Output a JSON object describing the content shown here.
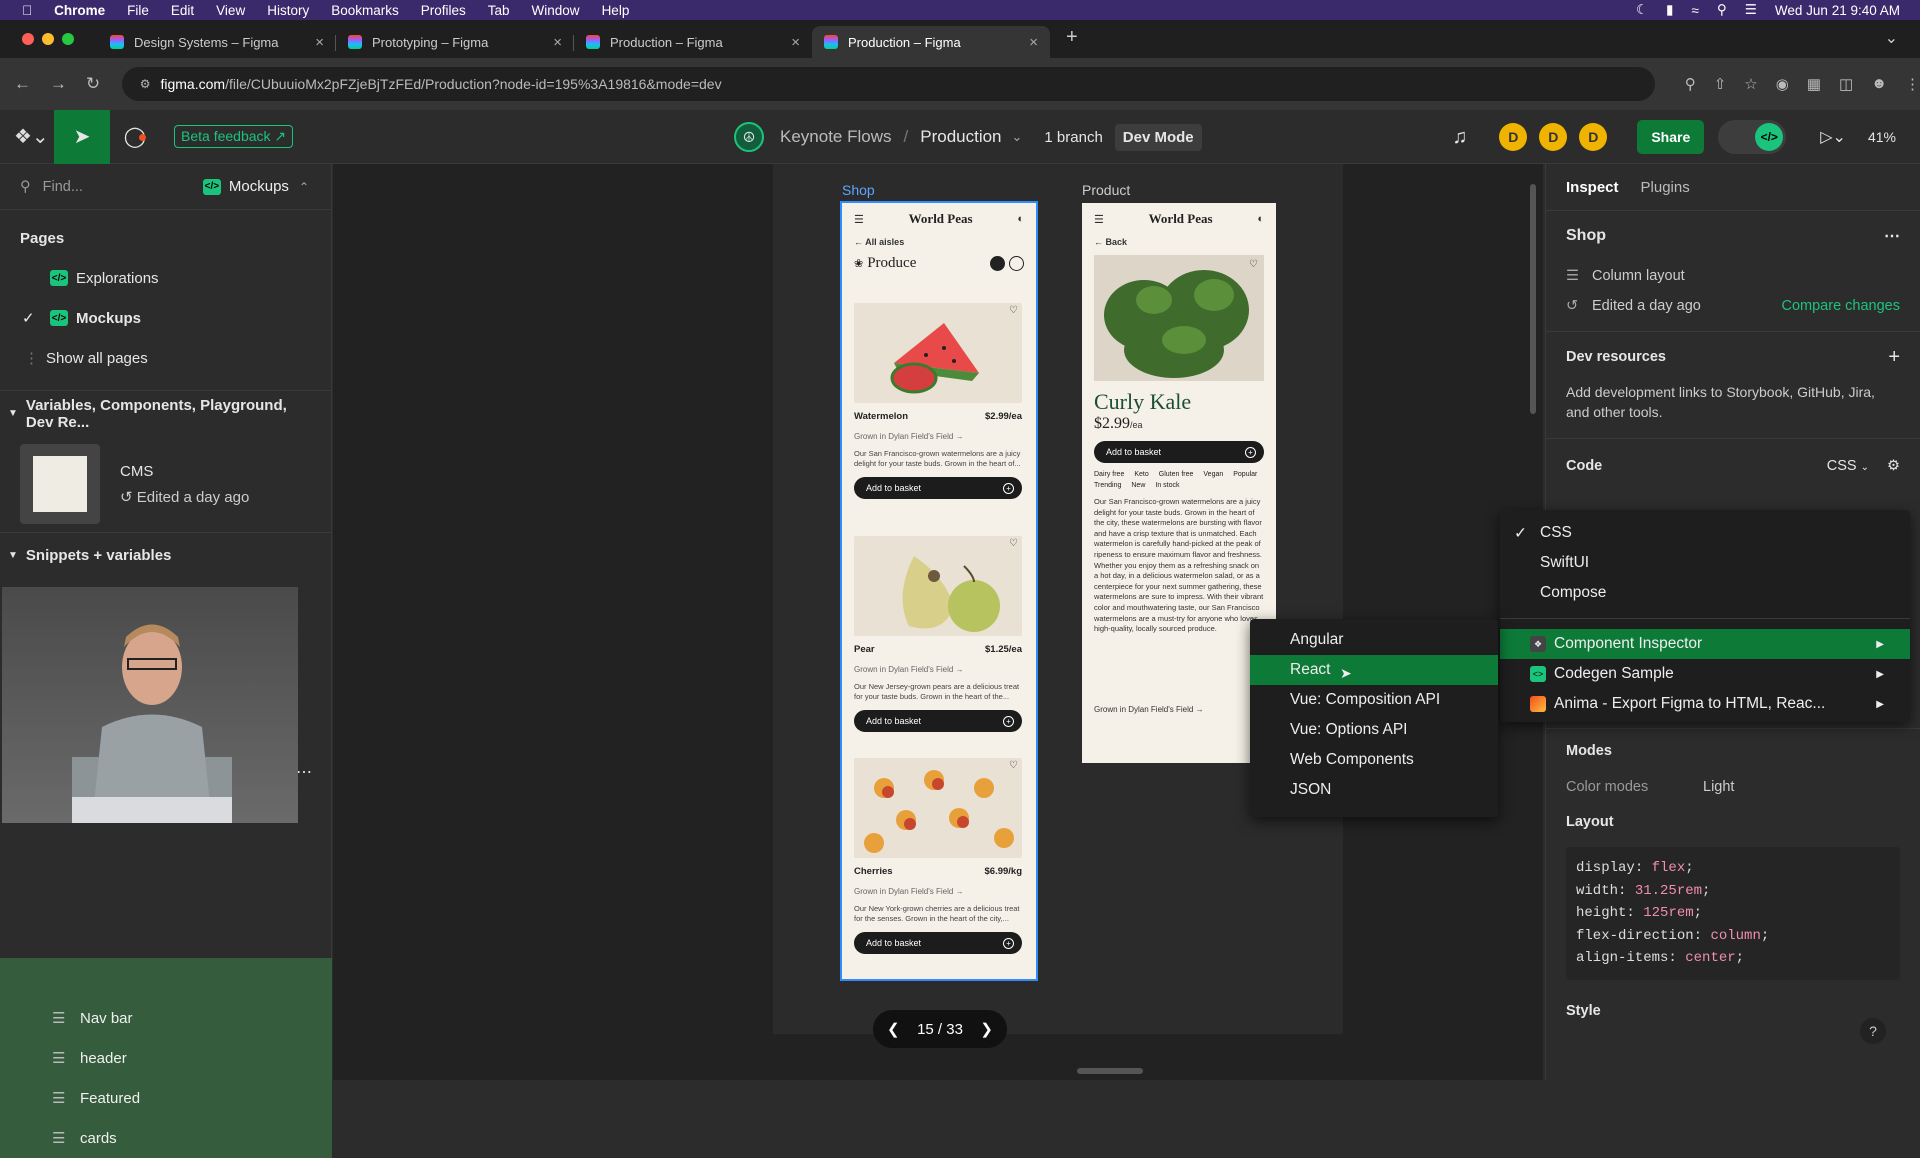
{
  "menubar": {
    "items": [
      "Chrome",
      "File",
      "Edit",
      "View",
      "History",
      "Bookmarks",
      "Profiles",
      "Tab",
      "Window",
      "Help"
    ],
    "clock": "Wed Jun 21  9:40 AM"
  },
  "tabs": [
    {
      "label": "Design Systems – Figma"
    },
    {
      "label": "Prototyping – Figma"
    },
    {
      "label": "Production – Figma"
    },
    {
      "label": "Production – Figma"
    }
  ],
  "url": {
    "host": "figma.com",
    "path": "/file/CUbuuioMx2pFZjeBjTzFEd/Production?node-id=195%3A19816&mode=dev"
  },
  "toolbar": {
    "beta_label": "Beta feedback",
    "project": "Keynote Flows",
    "file": "Production",
    "branch": "1 branch",
    "dev_mode": "Dev Mode",
    "avatars": [
      "D",
      "D",
      "D"
    ],
    "share": "Share",
    "zoom": "41%"
  },
  "left": {
    "find_placeholder": "Find...",
    "page_selector": "Mockups",
    "pages_heading": "Pages",
    "pages": [
      {
        "label": "Explorations"
      },
      {
        "label": "Mockups",
        "selected": true
      }
    ],
    "show_all": "Show all pages",
    "section1": "Variables, Components, Playground, Dev Re...",
    "cms_title": "CMS",
    "cms_edited": "Edited a day ago",
    "section2": "Snippets + variables",
    "layers": [
      "Nav bar",
      "header",
      "Featured",
      "cards"
    ]
  },
  "canvas": {
    "frame1_label": "Shop",
    "frame2_label": "Product",
    "brand": "World Peas",
    "all_aisles": "All aisles",
    "produce": "Produce",
    "back": "Back",
    "cards": [
      {
        "name": "Watermelon",
        "price": "$2.99/ea",
        "grown": "Grown in Dylan Field's Field →",
        "desc": "Our San Francisco-grown watermelons are a juicy delight for your taste buds. Grown in the heart of...",
        "basket": "Add to basket"
      },
      {
        "name": "Pear",
        "price": "$1.25/ea",
        "grown": "Grown in Dylan Field's Field →",
        "desc": "Our New Jersey-grown pears are a delicious treat for your taste buds. Grown in the heart of the...",
        "basket": "Add to basket"
      },
      {
        "name": "Cherries",
        "price": "$6.99/kg",
        "grown": "Grown in Dylan Field's Field →",
        "desc": "Our New York-grown cherries are a delicious treat for the senses. Grown in the heart of the city,...",
        "basket": "Add to basket"
      }
    ],
    "product": {
      "name": "Curly Kale",
      "price": "$2.99",
      "unit": "/ea",
      "basket": "Add to basket",
      "tags": [
        "Dairy free",
        "Keto",
        "Gluten free",
        "Vegan",
        "Popular",
        "Trending",
        "New",
        "In stock"
      ],
      "desc": "Our San Francisco-grown watermelons are a juicy delight for your taste buds. Grown in the heart of the city, these watermelons are bursting with flavor and have a crisp texture that is unmatched. Each watermelon is carefully hand-picked at the peak of ripeness to ensure maximum flavor and freshness. Whether you enjoy them as a refreshing snack on a hot day, in a delicious watermelon salad, or as a centerpiece for your next summer gathering, these watermelons are sure to impress. With their vibrant color and mouthwatering taste, our San Francisco watermelons are a must-try for anyone who loves high-quality, locally sourced produce.",
      "grown": "Grown in Dylan Field's Field →"
    },
    "pager": "15 / 33"
  },
  "menu_frameworks": [
    "Angular",
    "React",
    "Vue: Composition API",
    "Vue: Options API",
    "Web Components",
    "JSON"
  ],
  "menu_code": {
    "languages": [
      "CSS",
      "SwiftUI",
      "Compose"
    ],
    "plugins": [
      "Component Inspector",
      "Codegen Sample",
      "Anima - Export Figma to HTML, Reac..."
    ]
  },
  "right": {
    "tab_inspect": "Inspect",
    "tab_plugins": "Plugins",
    "frame_name": "Shop",
    "layout_type": "Column layout",
    "edited": "Edited a day ago",
    "compare": "Compare changes",
    "dev_resources": "Dev resources",
    "dev_desc": "Add development links to Storybook, GitHub, Jira, and other tools.",
    "code": "Code",
    "code_lang": "CSS",
    "modes": "Modes",
    "color_modes": "Color modes",
    "light": "Light",
    "layout": "Layout",
    "css": [
      [
        "display",
        "flex"
      ],
      [
        "width",
        "31.25rem"
      ],
      [
        "height",
        "125rem"
      ],
      [
        "flex-direction",
        "column"
      ],
      [
        "align-items",
        "center"
      ]
    ],
    "style": "Style"
  }
}
